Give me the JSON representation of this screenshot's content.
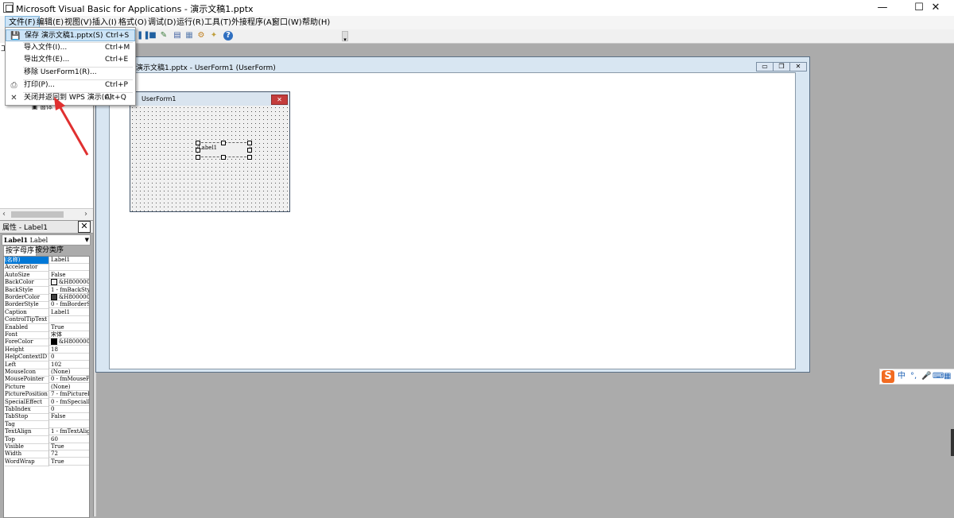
{
  "window": {
    "title": "Microsoft Visual Basic for Applications - 演示文稿1.pptx",
    "min": "—",
    "max": "☐",
    "close": "✕"
  },
  "menubar": {
    "items": [
      "文件(F)",
      "编辑(E)",
      "视图(V)",
      "插入(I)",
      "格式(O)",
      "调试(D)",
      "运行(R)",
      "工具(T)",
      "外接程序(A)",
      "窗口(W)",
      "帮助(H)"
    ]
  },
  "file_menu": {
    "items": [
      {
        "label": "保存 演示文稿1.pptx(S)",
        "shortcut": "Ctrl+S",
        "icon": "save-icon"
      },
      {
        "label": "导入文件(I)...",
        "shortcut": "Ctrl+M"
      },
      {
        "label": "导出文件(E)...",
        "shortcut": "Ctrl+E"
      },
      {
        "label": "移除 UserForm1(R)...",
        "shortcut": ""
      },
      {
        "label": "打印(P)...",
        "shortcut": "Ctrl+P",
        "icon": "print-icon"
      },
      {
        "label": "关闭并返回到 WPS 演示(C)",
        "shortcut": "Alt+Q",
        "icon": "close-icon"
      }
    ]
  },
  "project_panel": {
    "fragment": "工",
    "tree_fragment": "窗体"
  },
  "properties": {
    "title": "属性 - Label1",
    "object": "Label1",
    "object_type": "Label",
    "tabs": [
      "按字母序",
      "按分类序"
    ],
    "rows": [
      [
        "(名称)",
        "Label1"
      ],
      [
        "Accelerator",
        ""
      ],
      [
        "AutoSize",
        "False"
      ],
      [
        "BackColor",
        "&H8000000F&"
      ],
      [
        "BackStyle",
        "1 - fmBackStyleOpaque"
      ],
      [
        "BorderColor",
        "&H80000006&"
      ],
      [
        "BorderStyle",
        "0 - fmBorderStyleNone"
      ],
      [
        "Caption",
        "Label1"
      ],
      [
        "ControlTipText",
        ""
      ],
      [
        "Enabled",
        "True"
      ],
      [
        "Font",
        "宋体"
      ],
      [
        "ForeColor",
        "&H80000012&"
      ],
      [
        "Height",
        "18"
      ],
      [
        "HelpContextID",
        "0"
      ],
      [
        "Left",
        "102"
      ],
      [
        "MouseIcon",
        "(None)"
      ],
      [
        "MousePointer",
        "0 - fmMousePointerDefault"
      ],
      [
        "Picture",
        "(None)"
      ],
      [
        "PicturePosition",
        "7 - fmPicturePositionAboveCenter"
      ],
      [
        "SpecialEffect",
        "0 - fmSpecialEffectFlat"
      ],
      [
        "TabIndex",
        "0"
      ],
      [
        "TabStop",
        "False"
      ],
      [
        "Tag",
        ""
      ],
      [
        "TextAlign",
        "1 - fmTextAlignLeft"
      ],
      [
        "Top",
        "60"
      ],
      [
        "Visible",
        "True"
      ],
      [
        "Width",
        "72"
      ],
      [
        "WordWrap",
        "True"
      ]
    ],
    "swatches": {
      "BackColor": "#f0f0f0",
      "BorderColor": "#404040",
      "ForeColor": "#000000"
    }
  },
  "child_window": {
    "title": "演示文稿1.pptx - UserForm1 (UserForm)"
  },
  "userform": {
    "title": "UserForm1",
    "label_caption": "Label1"
  },
  "ime": {
    "chars": [
      "中",
      "°,",
      "🎤",
      "⌨",
      "▦",
      "👕"
    ]
  },
  "colors": {
    "accent": "#0078d7",
    "menu_highlight": "#cce4f7",
    "annotation_arrow": "#e03030"
  }
}
